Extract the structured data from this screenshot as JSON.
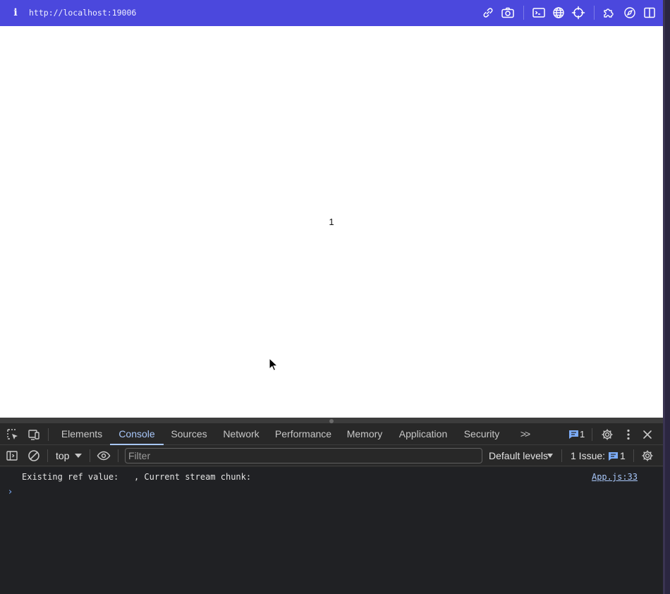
{
  "urlbar": {
    "info_glyph": "i",
    "url": "http://localhost:19006",
    "icons": [
      "link-icon",
      "camera-icon",
      "terminal-icon",
      "globe-icon",
      "crosshair-icon",
      "extension-icon",
      "compass-icon",
      "split-panel-icon"
    ]
  },
  "page": {
    "counter": "1"
  },
  "devtools": {
    "tabs": [
      {
        "label": "Elements"
      },
      {
        "label": "Console"
      },
      {
        "label": "Sources"
      },
      {
        "label": "Network"
      },
      {
        "label": "Performance"
      },
      {
        "label": "Memory"
      },
      {
        "label": "Application"
      },
      {
        "label": "Security"
      }
    ],
    "active_tab": "Console",
    "more_tabs_glyph": ">>",
    "message_count": "1",
    "close_glyph": "✕",
    "toolbar": {
      "context": "top",
      "filter_placeholder": "Filter",
      "levels": "Default levels",
      "issues_label": "1 Issue:",
      "issues_count": "1"
    },
    "console": {
      "log_text": "Existing ref value:   , Current stream chunk:",
      "log_source": "App.js:33",
      "prompt_glyph": "›"
    },
    "colors": {
      "accent": "#a8c7fa",
      "background": "#282828",
      "urlbar": "#4b48dd"
    }
  }
}
